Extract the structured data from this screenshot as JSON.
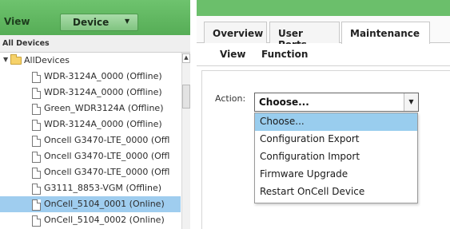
{
  "left_panel": {
    "view_label": "View",
    "device_dropdown": {
      "label": "Device",
      "arrow": "▼"
    },
    "header_label": "All Devices",
    "tree": {
      "root": {
        "label": "AllDevices",
        "expander": "▼",
        "icon": "folder-icon"
      },
      "items": [
        {
          "label": "WDR-3124A_0000 (Offline)",
          "selected": false
        },
        {
          "label": "WDR-3124A_0000 (Offline)",
          "selected": false
        },
        {
          "label": "Green_WDR3124A (Offline)",
          "selected": false
        },
        {
          "label": "WDR-3124A_0000 (Offline)",
          "selected": false
        },
        {
          "label": "Oncell G3470-LTE_0000 (Offl",
          "selected": false
        },
        {
          "label": "Oncell G3470-LTE_0000 (Offl",
          "selected": false
        },
        {
          "label": "Oncell G3470-LTE_0000 (Offl",
          "selected": false
        },
        {
          "label": "G3111_8853-VGM (Offline)",
          "selected": false
        },
        {
          "label": "OnCell_5104_0001 (Online)",
          "selected": true
        },
        {
          "label": "OnCell_5104_0002 (Online)",
          "selected": false
        }
      ]
    },
    "scrollbar": {
      "up_arrow": "▲"
    }
  },
  "right_panel": {
    "tabs": [
      {
        "label": "Overview",
        "active": false
      },
      {
        "label": "User Ports",
        "active": false
      },
      {
        "label": "Maintenance",
        "active": true
      }
    ],
    "subtabs": [
      {
        "label": "View"
      },
      {
        "label": "Function"
      }
    ],
    "action": {
      "label": "Action:",
      "selected_value": "Choose...",
      "arrow": "▼",
      "options": [
        {
          "label": "Choose...",
          "highlighted": true
        },
        {
          "label": "Configuration Export",
          "highlighted": false
        },
        {
          "label": "Configuration Import",
          "highlighted": false
        },
        {
          "label": "Firmware Upgrade",
          "highlighted": false
        },
        {
          "label": "Restart OnCell Device",
          "highlighted": false
        }
      ]
    }
  },
  "colors": {
    "header_green": "#5cb85c",
    "selection_blue": "#9fcdef",
    "menu_highlight": "#99cdee"
  }
}
